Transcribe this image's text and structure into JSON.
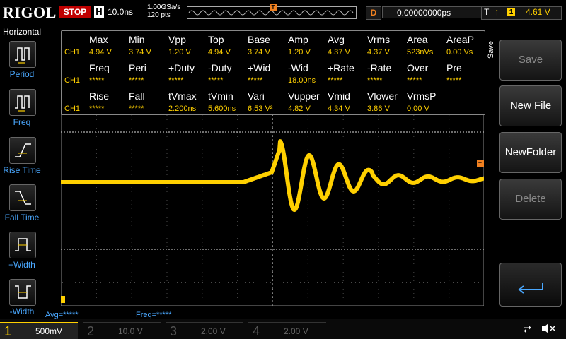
{
  "topbar": {
    "brand": "RIGOL",
    "run_state": "STOP",
    "timebase_letter": "H",
    "timebase_value": "10.0ns",
    "sample_rate": "1.00GSa/s",
    "points": "120 pts",
    "trigger_marker": "T",
    "delay_letter": "D",
    "delay_value": "0.00000000ps",
    "trigger_letter": "T",
    "trigger_edge_icon": "rising-edge-icon",
    "trigger_source": "1",
    "trigger_level": "4.61 V",
    "colors": {
      "run_state_bg": "#c00000",
      "accent_orange": "#f08020",
      "ch1_yellow": "#ffd000"
    }
  },
  "left_panel": {
    "title": "Horizontal",
    "buttons": [
      {
        "label": "Period",
        "icon": "period-icon"
      },
      {
        "label": "Freq",
        "icon": "frequency-icon"
      },
      {
        "label": "Rise Time",
        "icon": "rise-time-icon"
      },
      {
        "label": "Fall Time",
        "icon": "fall-time-icon"
      },
      {
        "label": "+Width",
        "icon": "positive-width-icon"
      },
      {
        "label": "-Width",
        "icon": "negative-width-icon"
      }
    ]
  },
  "measurements": {
    "channel_label": "CH1",
    "rows": [
      {
        "headers": [
          "Max",
          "Min",
          "Vpp",
          "Top",
          "Base",
          "Amp",
          "Avg",
          "Vrms",
          "Area",
          "AreaP"
        ],
        "values": [
          "4.94 V",
          "3.74 V",
          "1.20 V",
          "4.94 V",
          "3.74 V",
          "1.20 V",
          "4.37 V",
          "4.37 V",
          "523nVs",
          "0.00 Vs"
        ]
      },
      {
        "headers": [
          "Freq",
          "Peri",
          "+Duty",
          "-Duty",
          "+Wid",
          "-Wid",
          "+Rate",
          "-Rate",
          "Over",
          "Pre"
        ],
        "values": [
          "*****",
          "*****",
          "*****",
          "*****",
          "*****",
          "18.00ns",
          "*****",
          "*****",
          "*****",
          "*****"
        ]
      },
      {
        "headers": [
          "Rise",
          "Fall",
          "tVmax",
          "tVmin",
          "Vari",
          "Vupper",
          "Vmid",
          "Vlower",
          "VrmsP",
          ""
        ],
        "values": [
          "*****",
          "*****",
          "2.200ns",
          "5.600ns",
          "6.53 V²",
          "4.82 V",
          "4.34 V",
          "3.86 V",
          "0.00 V",
          ""
        ]
      }
    ]
  },
  "right_panel": {
    "menu_title": "Save",
    "buttons": [
      {
        "label": "Save",
        "enabled": false
      },
      {
        "label": "New File",
        "enabled": true
      },
      {
        "label": "NewFolder",
        "enabled": true
      },
      {
        "label": "Delete",
        "enabled": false
      }
    ],
    "enter_icon": "enter-arrow-icon"
  },
  "status": {
    "avg": "Avg=*****",
    "freq": "Freq=*****"
  },
  "channels": [
    {
      "num": "1",
      "scale": "500mV",
      "active": true,
      "color": "#ffd000"
    },
    {
      "num": "2",
      "scale": "10.0 V",
      "active": false,
      "color": "#00b8c8"
    },
    {
      "num": "3",
      "scale": "2.00 V",
      "active": false,
      "color": "#c040c0"
    },
    {
      "num": "4",
      "scale": "2.00 V",
      "active": false,
      "color": "#3060ff"
    }
  ],
  "system_icons": [
    "usb-icon",
    "sound-muted-icon"
  ]
}
